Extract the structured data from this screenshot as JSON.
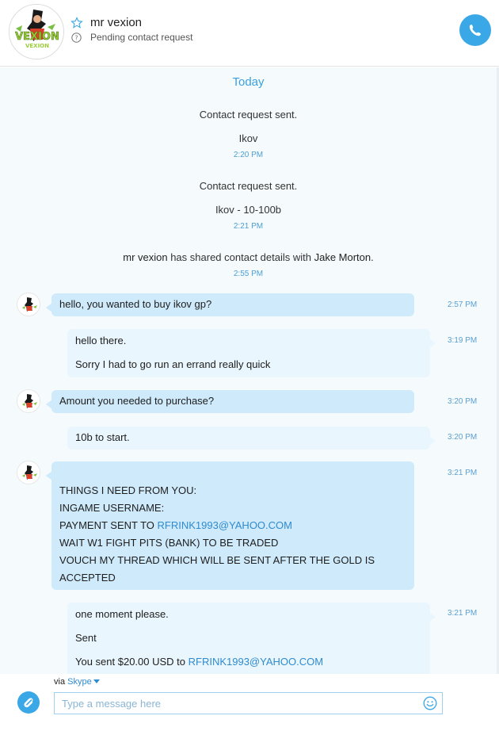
{
  "header": {
    "contact_name": "mr vexion",
    "status": "Pending contact request",
    "avatar_text": "VEXION"
  },
  "conversation": {
    "day_divider": "Today",
    "system_events": [
      {
        "text": "Contact request sent.",
        "note": "Ikov",
        "time": "2:20 PM"
      },
      {
        "text": "Contact request sent.",
        "note": "Ikov - 10-100b",
        "time": "2:21 PM"
      }
    ],
    "share_event": {
      "actor": "mr vexion",
      "middle": " has shared contact details with ",
      "target": "Jake Morton",
      "end": ".",
      "time": "2:55 PM"
    },
    "messages": [
      {
        "direction": "in",
        "lines": [
          "hello, you wanted to buy ikov gp?"
        ],
        "time": "2:57 PM"
      },
      {
        "direction": "out",
        "lines": [
          "hello there.",
          "Sorry I had to go run an errand really quick"
        ],
        "time": "3:19 PM"
      },
      {
        "direction": "in",
        "lines": [
          "Amount you needed to purchase?"
        ],
        "time": "3:20 PM"
      },
      {
        "direction": "out",
        "lines": [
          "10b to start."
        ],
        "time": "3:20 PM"
      },
      {
        "direction": "in",
        "lines": [
          "THINGS I NEED FROM YOU:",
          "INGAME USERNAME:",
          "PAYMENT SENT TO ",
          "WAIT W1 FIGHT PITS (BANK) TO BE TRADED",
          "VOUCH MY THREAD WHICH WILL BE SENT AFTER THE GOLD IS",
          "ACCEPTED"
        ],
        "email": "RFRINK1993@YAHOO.COM",
        "time": "3:21 PM"
      },
      {
        "direction": "out",
        "lines": [
          "one moment please.",
          "Sent",
          "You sent $20.00 USD to "
        ],
        "email": "RFRINK1993@YAHOO.COM",
        "time": "3:21 PM"
      }
    ]
  },
  "footer": {
    "via_label": "via",
    "via_service": "Skype",
    "composer_placeholder": "Type a message here"
  },
  "colors": {
    "accent": "#3aa7e6",
    "incoming_bubble": "#cfeafb",
    "outgoing_bubble": "#eaf6fd",
    "link": "#2e8bd0"
  },
  "icons": [
    "star-icon",
    "help-icon",
    "phone-icon",
    "paperclip-icon",
    "smiley-icon",
    "caret-down-icon"
  ]
}
